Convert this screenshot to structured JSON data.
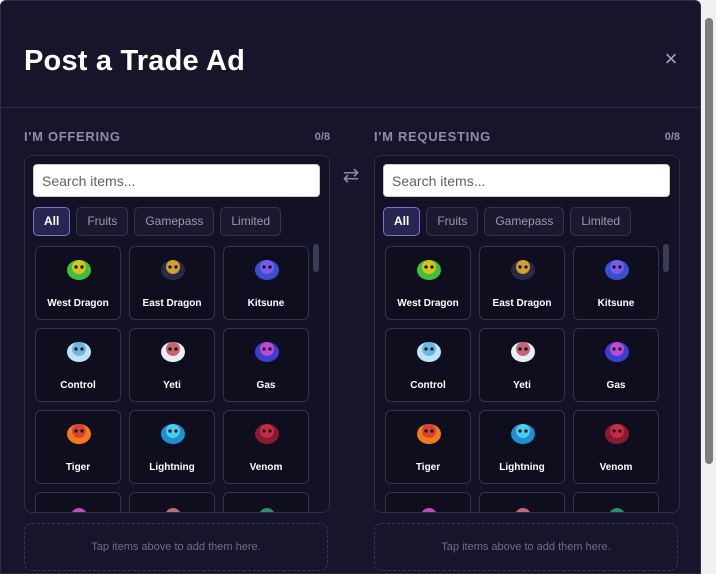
{
  "modal": {
    "title": "Post a Trade Ad",
    "close_label": "×"
  },
  "swap_label": "⇄",
  "columns": [
    {
      "title": "I'M OFFERING",
      "count": "0/8",
      "search_placeholder": "Search items...",
      "filters": [
        "All",
        "Fruits",
        "Gamepass",
        "Limited"
      ],
      "active_filter": "All",
      "items": [
        "West Dragon",
        "East Dragon",
        "Kitsune",
        "Control",
        "Yeti",
        "Gas",
        "Tiger",
        "Lightning",
        "Venom"
      ],
      "drop_hint": "Tap items above to add them here."
    },
    {
      "title": "I'M REQUESTING",
      "count": "0/8",
      "search_placeholder": "Search items...",
      "filters": [
        "All",
        "Fruits",
        "Gamepass",
        "Limited"
      ],
      "active_filter": "All",
      "items": [
        "West Dragon",
        "East Dragon",
        "Kitsune",
        "Control",
        "Yeti",
        "Gas",
        "Tiger",
        "Lightning",
        "Venom"
      ],
      "drop_hint": "Tap items above to add them here."
    }
  ],
  "item_icons": {
    "West Dragon": {
      "name": "west-dragon-icon",
      "colors": [
        "#3fbf3a",
        "#f2c21a"
      ]
    },
    "East Dragon": {
      "name": "east-dragon-icon",
      "colors": [
        "#2b2a45",
        "#f0b52a"
      ]
    },
    "Kitsune": {
      "name": "kitsune-icon",
      "colors": [
        "#3a4fd0",
        "#8a5cf0"
      ]
    },
    "Control": {
      "name": "control-icon",
      "colors": [
        "#bfe3f5",
        "#5aaee0"
      ]
    },
    "Yeti": {
      "name": "yeti-icon",
      "colors": [
        "#e8eef5",
        "#c24a5a"
      ]
    },
    "Gas": {
      "name": "gas-icon",
      "colors": [
        "#3b3fd0",
        "#d84ad8"
      ]
    },
    "Tiger": {
      "name": "tiger-icon",
      "colors": [
        "#f27a1a",
        "#d23a3a"
      ]
    },
    "Lightning": {
      "name": "lightning-icon",
      "colors": [
        "#1e8fd0",
        "#55d8f0"
      ]
    },
    "Venom": {
      "name": "venom-icon",
      "colors": [
        "#8a1a2e",
        "#d0304a"
      ]
    }
  },
  "partial_row_colors": [
    "#c04ac0",
    "#c06a7a",
    "#2f8f6a"
  ]
}
